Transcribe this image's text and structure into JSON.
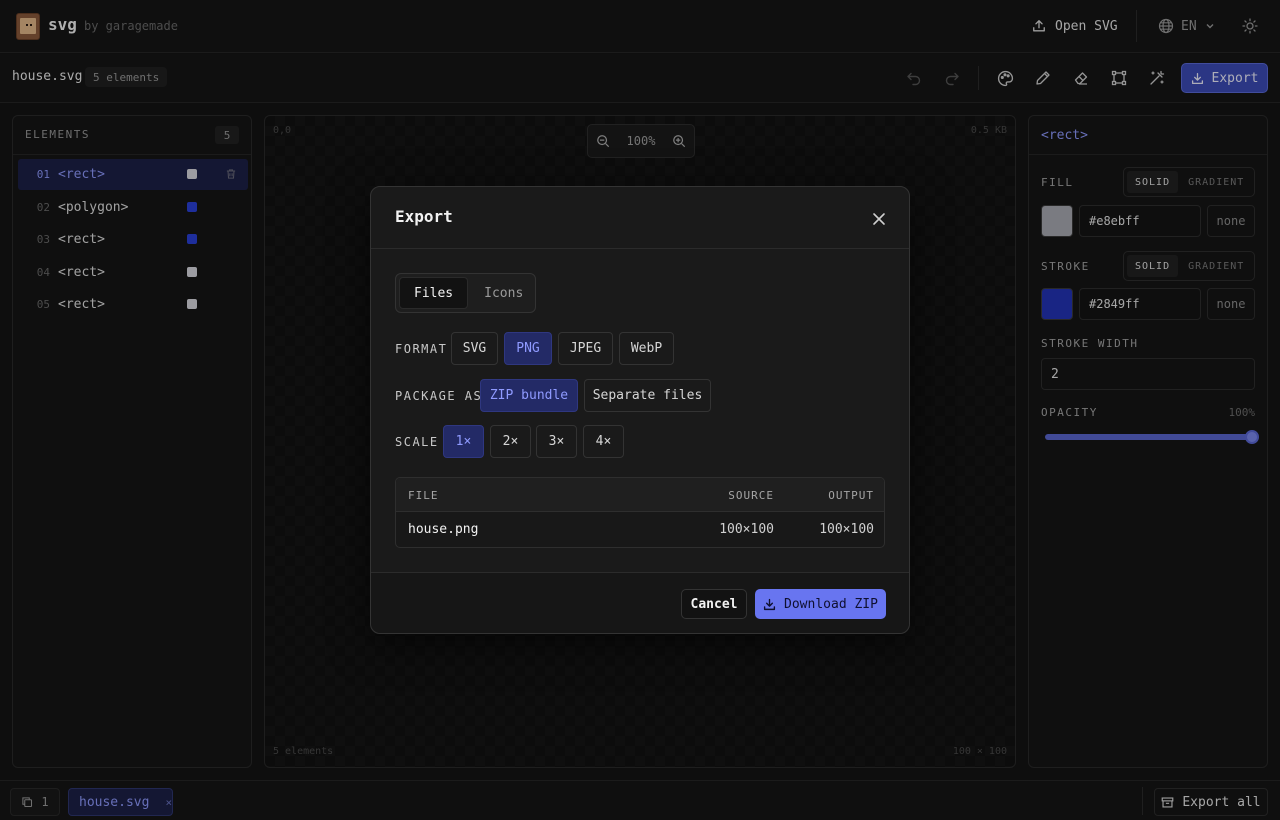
{
  "app": {
    "name": "svg",
    "byline": "by garagemade"
  },
  "header": {
    "open_label": "Open SVG",
    "lang": "EN"
  },
  "toolbar": {
    "filename": "house.svg",
    "element_count": "5 elements",
    "export_label": "Export"
  },
  "elements_panel": {
    "title": "ELEMENTS",
    "count": "5",
    "items": [
      {
        "num": "01",
        "tag": "<rect>",
        "color": "#e8ebff",
        "selected": true
      },
      {
        "num": "02",
        "tag": "<polygon>",
        "color": "#2849ff",
        "selected": false
      },
      {
        "num": "03",
        "tag": "<rect>",
        "color": "#2849ff",
        "selected": false
      },
      {
        "num": "04",
        "tag": "<rect>",
        "color": "#e8ebff",
        "selected": false
      },
      {
        "num": "05",
        "tag": "<rect>",
        "color": "#e8ebff",
        "selected": false
      }
    ]
  },
  "canvas": {
    "origin": "0,0",
    "size_kb": "0.5 KB",
    "zoom": "100%",
    "footer_left": "5 elements",
    "footer_right": "100 × 100"
  },
  "props": {
    "title": "<rect>",
    "fill_label": "FILL",
    "stroke_label": "STROKE",
    "mode_solid": "SOLID",
    "mode_gradient": "GRADIENT",
    "fill_hex": "#e8ebff",
    "fill_swatch": "#a9abb3",
    "stroke_hex": "#2849ff",
    "stroke_swatch": "#2334b8",
    "none_label": "none",
    "stroke_width_label": "STROKE WIDTH",
    "stroke_width": "2",
    "opacity_label": "OPACITY",
    "opacity": "100%"
  },
  "footer": {
    "page_count": "1",
    "tab_name": "house.svg",
    "tab_close": "×",
    "export_all": "Export all"
  },
  "export_modal": {
    "title": "Export",
    "tabs": [
      {
        "label": "Files",
        "active": true
      },
      {
        "label": "Icons",
        "active": false
      }
    ],
    "format_label": "FORMAT",
    "formats": [
      {
        "label": "SVG",
        "active": false
      },
      {
        "label": "PNG",
        "active": true
      },
      {
        "label": "JPEG",
        "active": false
      },
      {
        "label": "WebP",
        "active": false
      }
    ],
    "package_label": "PACKAGE AS",
    "packages": [
      {
        "label": "ZIP bundle",
        "active": true
      },
      {
        "label": "Separate files",
        "active": false
      }
    ],
    "scale_label": "SCALE",
    "scales": [
      {
        "label": "1×",
        "active": true
      },
      {
        "label": "2×",
        "active": false
      },
      {
        "label": "3×",
        "active": false
      },
      {
        "label": "4×",
        "active": false
      }
    ],
    "table": {
      "headers": [
        "FILE",
        "SOURCE",
        "OUTPUT"
      ],
      "rows": [
        {
          "file": "house.png",
          "source": "100×100",
          "output": "100×100"
        }
      ]
    },
    "cancel_label": "Cancel",
    "download_label": "Download ZIP"
  },
  "colors": {
    "accent": "#5c69d6",
    "accent_text": "#8f9aff",
    "selected_bg": "#1d2147"
  }
}
